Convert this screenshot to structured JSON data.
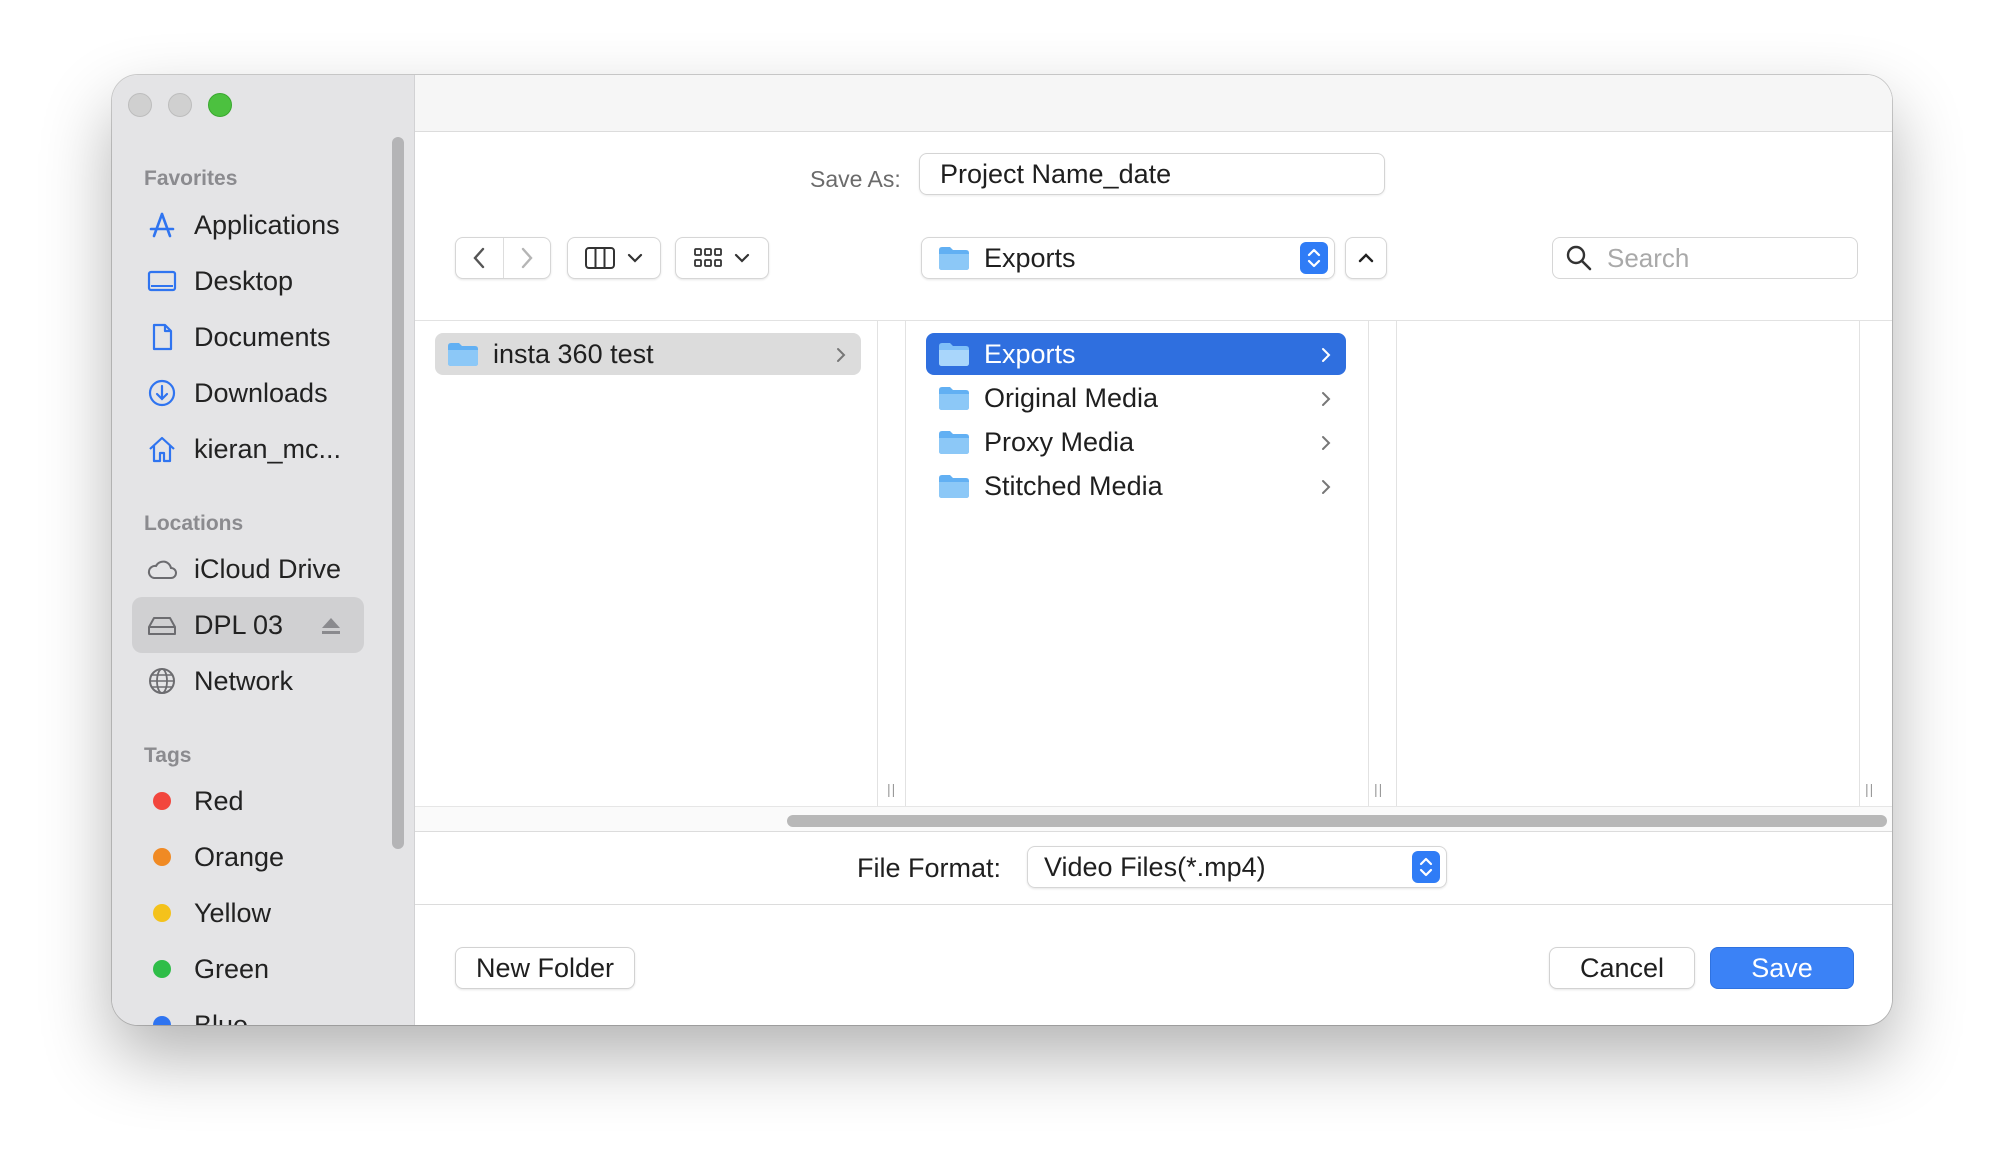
{
  "sidebar": {
    "favorites_heading": "Favorites",
    "favorites": [
      {
        "label": "Applications",
        "icon": "applications-icon"
      },
      {
        "label": "Desktop",
        "icon": "desktop-icon"
      },
      {
        "label": "Documents",
        "icon": "document-icon"
      },
      {
        "label": "Downloads",
        "icon": "download-icon"
      },
      {
        "label": "kieran_mc...",
        "icon": "home-icon"
      }
    ],
    "locations_heading": "Locations",
    "locations": [
      {
        "label": "iCloud Drive",
        "icon": "cloud-icon"
      },
      {
        "label": "DPL 03",
        "icon": "drive-icon",
        "selected": true
      },
      {
        "label": "Network",
        "icon": "globe-icon"
      }
    ],
    "tags_heading": "Tags",
    "tags": [
      {
        "label": "Red",
        "color": "#f2463d"
      },
      {
        "label": "Orange",
        "color": "#f08a24"
      },
      {
        "label": "Yellow",
        "color": "#f4c21b"
      },
      {
        "label": "Green",
        "color": "#2ebd48"
      },
      {
        "label": "Blue",
        "color": "#2f74f0"
      }
    ]
  },
  "save_as": {
    "label": "Save As:",
    "value": "Project Name_date"
  },
  "toolbar": {
    "current_folder": "Exports",
    "search_placeholder": "Search"
  },
  "columns": {
    "col1": [
      {
        "label": "insta 360 test",
        "selected": true
      }
    ],
    "col2": [
      {
        "label": "Exports",
        "selected": true
      },
      {
        "label": "Original Media"
      },
      {
        "label": "Proxy Media"
      },
      {
        "label": "Stitched Media"
      }
    ]
  },
  "file_format": {
    "label": "File Format:",
    "value": "Video Files(*.mp4)"
  },
  "footer": {
    "new_folder": "New Folder",
    "cancel": "Cancel",
    "save": "Save"
  },
  "colors": {
    "accent": "#3b82f6",
    "selection": "#2f6fdf",
    "folder": "#5eaef2"
  }
}
